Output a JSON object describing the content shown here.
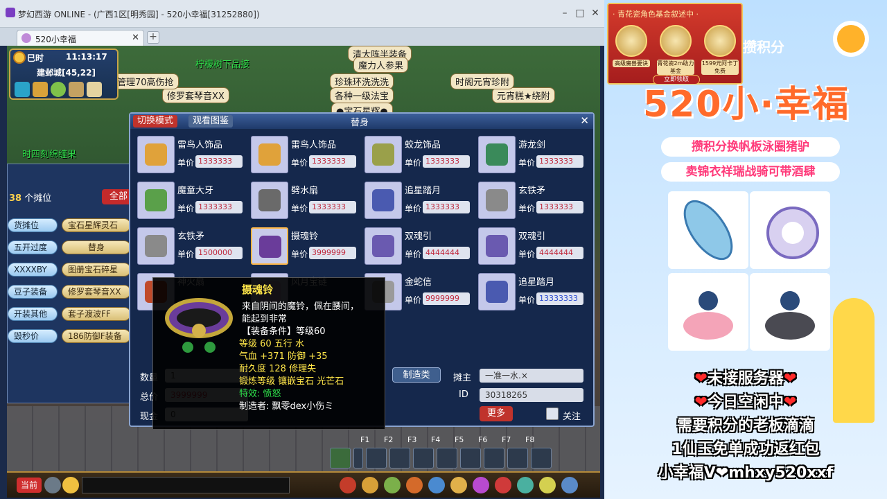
{
  "window": {
    "title": "梦幻西游 ONLINE - (广西1区[明秀园] - 520小幸福[31252880])",
    "tab_label": "520小幸福"
  },
  "hud": {
    "time_label": "巳时",
    "clock": "11:13:17",
    "location": "建邺城[45,22]"
  },
  "scene": {
    "npc_labels": [
      "清大阵半装备",
      "魔力人参果",
      "珍珠环洗洗洗",
      "各种一级法宝",
      "修罗套琴音XX",
      "元宵糕★绕附",
      "管理70高伤抢",
      "●宝石星辉●",
      "时阁元宵珍附"
    ],
    "green_labels": [
      "柠檬树下品接",
      "时四刻绵缠果"
    ]
  },
  "left_panel": {
    "stall_prefix": "",
    "stall_count": "38",
    "stall_suffix": "个摊位",
    "all_button": "全部",
    "rows": [
      {
        "left": "货摊位",
        "right": "宝石星辉灵石"
      },
      {
        "left": "五开过度",
        "right": "替身"
      },
      {
        "left": "XXXXBY",
        "right": "图册宝石碎星"
      },
      {
        "left": "豆子装备",
        "right": "修罗套琴音XX"
      },
      {
        "left": "开装其他",
        "right": "套子渡波FF"
      },
      {
        "left": "毁秒价",
        "right": "186防御F装备"
      }
    ]
  },
  "dialog": {
    "tab_switch": "切换模式",
    "tab_view": "观看图鉴",
    "title": "替身",
    "price_label": "单价",
    "items": [
      {
        "name": "雷鸟人饰品",
        "price": "1333333",
        "blue": false,
        "selected": false
      },
      {
        "name": "雷鸟人饰品",
        "price": "1333333",
        "blue": false,
        "selected": false
      },
      {
        "name": "蛟龙饰品",
        "price": "1333333",
        "blue": false,
        "selected": false
      },
      {
        "name": "游龙剑",
        "price": "1333333",
        "blue": false,
        "selected": false
      },
      {
        "name": "魔童大牙",
        "price": "1333333",
        "blue": false,
        "selected": false
      },
      {
        "name": "劈水扇",
        "price": "1333333",
        "blue": false,
        "selected": false
      },
      {
        "name": "追星踏月",
        "price": "1333333",
        "blue": false,
        "selected": false
      },
      {
        "name": "玄铁矛",
        "price": "1333333",
        "blue": false,
        "selected": false
      },
      {
        "name": "玄铁矛",
        "price": "1500000",
        "blue": false,
        "selected": false
      },
      {
        "name": "摄魂铃",
        "price": "3999999",
        "blue": false,
        "selected": true
      },
      {
        "name": "双魂引",
        "price": "4444444",
        "blue": false,
        "selected": false
      },
      {
        "name": "双魂引",
        "price": "4444444",
        "blue": false,
        "selected": false
      },
      {
        "name": "神火扇",
        "price": "",
        "blue": false,
        "selected": false
      },
      {
        "name": "风月宝链",
        "price": "",
        "blue": false,
        "selected": false
      },
      {
        "name": "金蛇信",
        "price": "9999999",
        "blue": false,
        "selected": false
      },
      {
        "name": "追星踏月",
        "price": "13333333",
        "blue": true,
        "selected": false
      }
    ],
    "qty_label": "数量",
    "qty_value": "1",
    "total_label": "总价",
    "total_value": "3999999",
    "cash_label": "现金",
    "cash_value": "0",
    "make_btn": "制造类",
    "owner_label": "摊主",
    "owner_value": "一准一水.×",
    "id_label": "ID",
    "id_value": "30318265",
    "more_btn": "更多",
    "follow_label": "关注"
  },
  "tooltip": {
    "title": "摄魂铃",
    "lines": [
      {
        "text": "来自阴间的魔铃，佩在腰间，",
        "color": "#ffffff"
      },
      {
        "text": "能起到非常",
        "color": "#ffffff"
      },
      {
        "text": "【装备条件】等级60",
        "color": "#ffffff"
      },
      {
        "text": "等级 60  五行 水",
        "color": "#ffe64a"
      },
      {
        "text": "气血 +371 防御 +35",
        "color": "#ffe64a"
      },
      {
        "text": "耐久度 128  修理失",
        "color": "#ffe64a"
      },
      {
        "text": "锻炼等级    镶嵌宝石 光芒石",
        "color": "#ffe64a"
      },
      {
        "text": "特效: 愤怒",
        "color": "#2ee04a"
      },
      {
        "text": "制造者: 飘零dex小伤ミ",
        "color": "#ffffff"
      }
    ]
  },
  "fkeys": [
    "F1",
    "F2",
    "F3",
    "F4",
    "F5",
    "F6",
    "F7",
    "F8"
  ],
  "bottom": {
    "chat_tab": "当前"
  },
  "promo": {
    "banner_title": "· 青花瓷角色基金叙述中 ·",
    "banner_subs": [
      "高级魔兽要诀",
      "青花瓷2m助力基金",
      "1599元阿卡丁免费"
    ],
    "banner_btn": "立即领取",
    "cloud_title": "攒积分",
    "big_title": "520小·幸福",
    "pill1": "攒积分换帆板泳圈猪驴",
    "pill2": "卖锦衣祥瑞战骑可带酒肆",
    "msg1": "未接服务器",
    "msg2": "今日空闲中",
    "msg3": "需要积分的老板滴滴",
    "msg4": "1仙玉免单成功返红包",
    "msg5": "小幸福V❤mhxy520xxf"
  }
}
